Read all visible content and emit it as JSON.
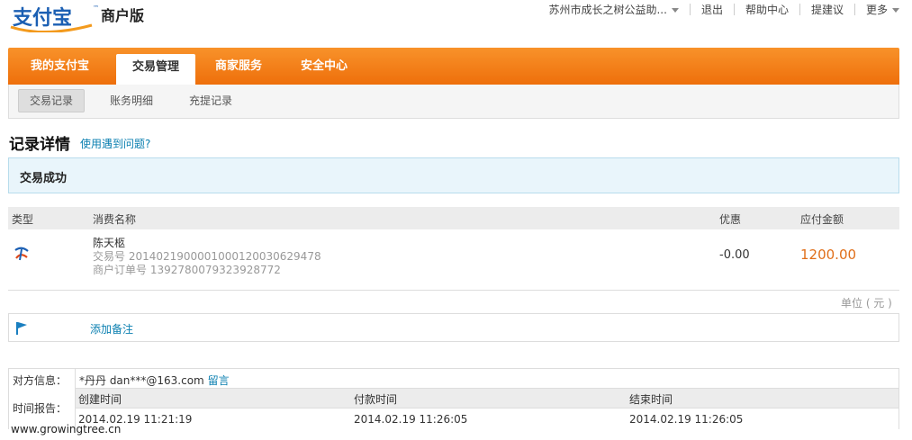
{
  "header": {
    "logo_text": "支付宝",
    "version": "商户版",
    "account": "苏州市成长之树公益助...",
    "links": [
      "退出",
      "帮助中心",
      "提建议",
      "更多"
    ]
  },
  "main_nav": {
    "tabs": [
      "我的支付宝",
      "交易管理",
      "商家服务",
      "安全中心"
    ],
    "active": "交易管理"
  },
  "sub_nav": {
    "items": [
      "交易记录",
      "账务明细",
      "充提记录"
    ],
    "active": "交易记录"
  },
  "page": {
    "title": "记录详情",
    "help_link": "使用遇到问题?",
    "status": "交易成功"
  },
  "table": {
    "headers": {
      "type": "类型",
      "name": "消费名称",
      "discount": "优惠",
      "amount": "应付金额"
    },
    "row": {
      "icon": "alipay-transfer-icon",
      "name": "陈天柩",
      "trade_no": "交易号 2014021900001000120030629478",
      "order_no": "商户订单号 1392780079323928772",
      "discount": "-0.00",
      "amount": "1200.00"
    },
    "unit": "单位 ( 元 )"
  },
  "remark": {
    "label": "添加备注",
    "icon": "flag-icon"
  },
  "info": {
    "counterparty_label": "对方信息：",
    "counterparty": "*丹丹  dan***@163.com",
    "message_link": "留言",
    "time_label": "时间报告：",
    "created_label": "创建时间",
    "paid_label": "付款时间",
    "finished_label": "结束时间",
    "created": "2014.02.19 11:21:19",
    "paid": "2014.02.19 11:26:05",
    "finished": "2014.02.19 11:26:05"
  },
  "watermark": "www.growingtree.cn",
  "colors": {
    "accent_orange": "#ef7511",
    "link_blue": "#0a7fb0",
    "amount_orange": "#e06f1a",
    "success_bg": "#e9f5fb"
  }
}
